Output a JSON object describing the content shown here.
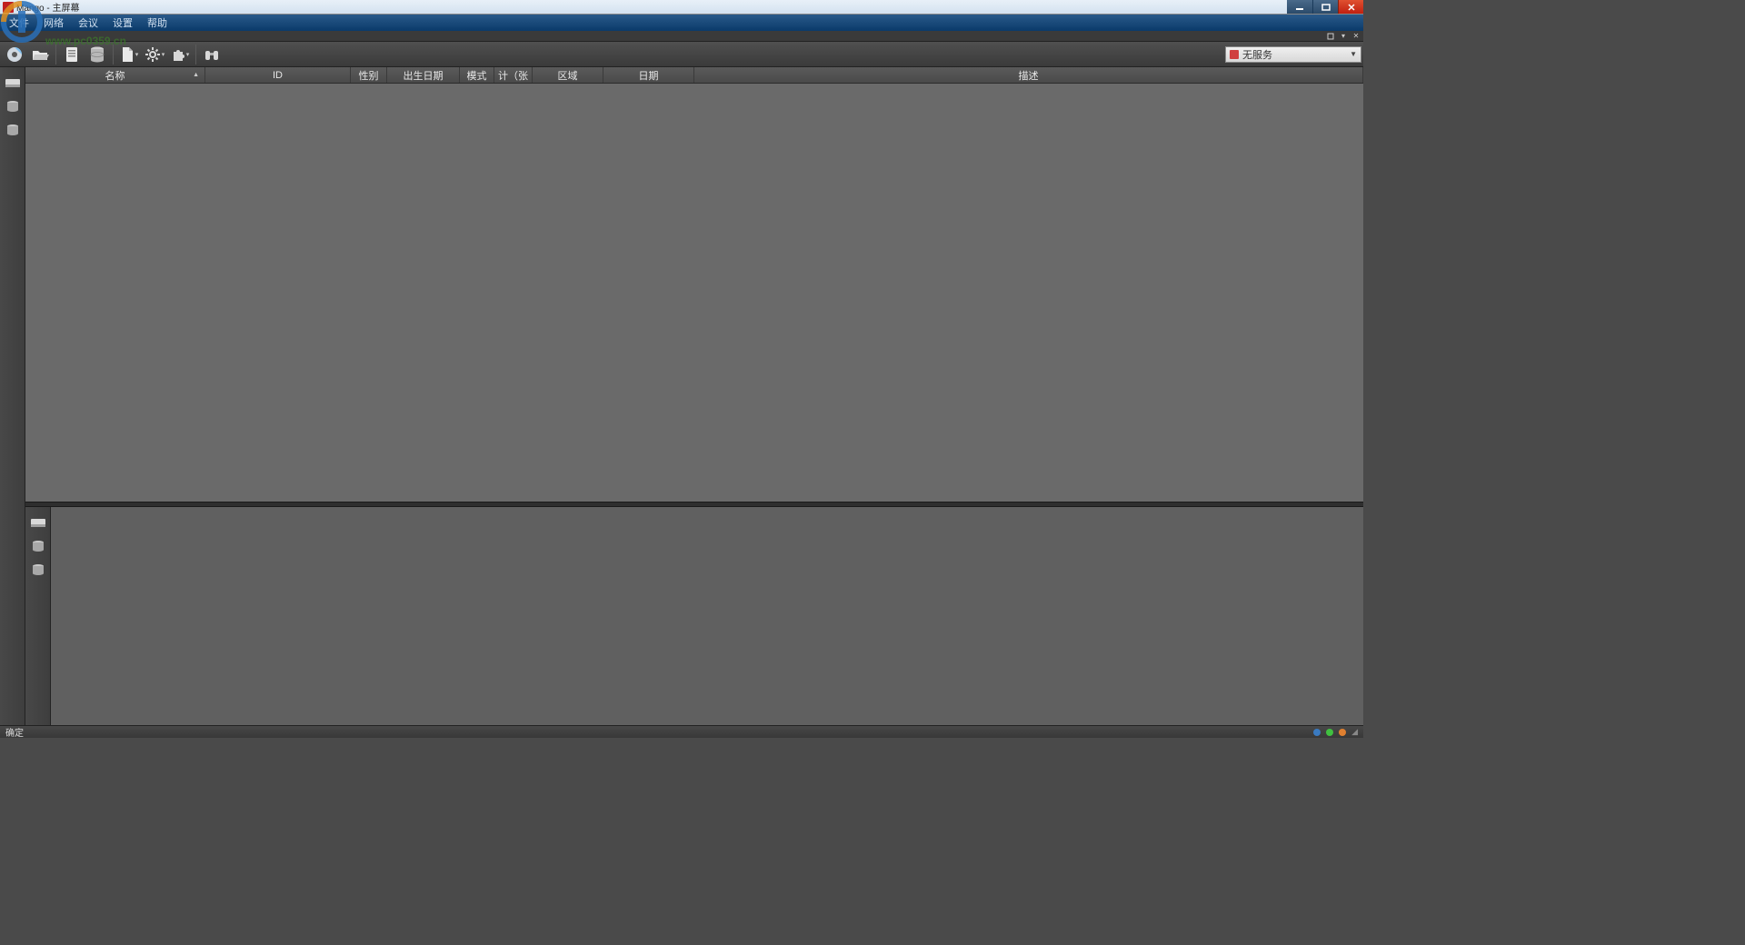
{
  "title": "Mango - 主屏幕",
  "watermark": "www.pc0359.cn",
  "menu": {
    "file": "文件",
    "network": "网络",
    "meeting": "会议",
    "settings": "设置",
    "help": "帮助"
  },
  "toolbar": {
    "service_label": "无服务"
  },
  "columns": {
    "name": "名称",
    "id": "ID",
    "gender": "性别",
    "birth": "出生日期",
    "mode": "模式",
    "count": "计（张",
    "region": "区域",
    "date": "日期",
    "desc": "描述"
  },
  "status": {
    "ok": "确定"
  }
}
